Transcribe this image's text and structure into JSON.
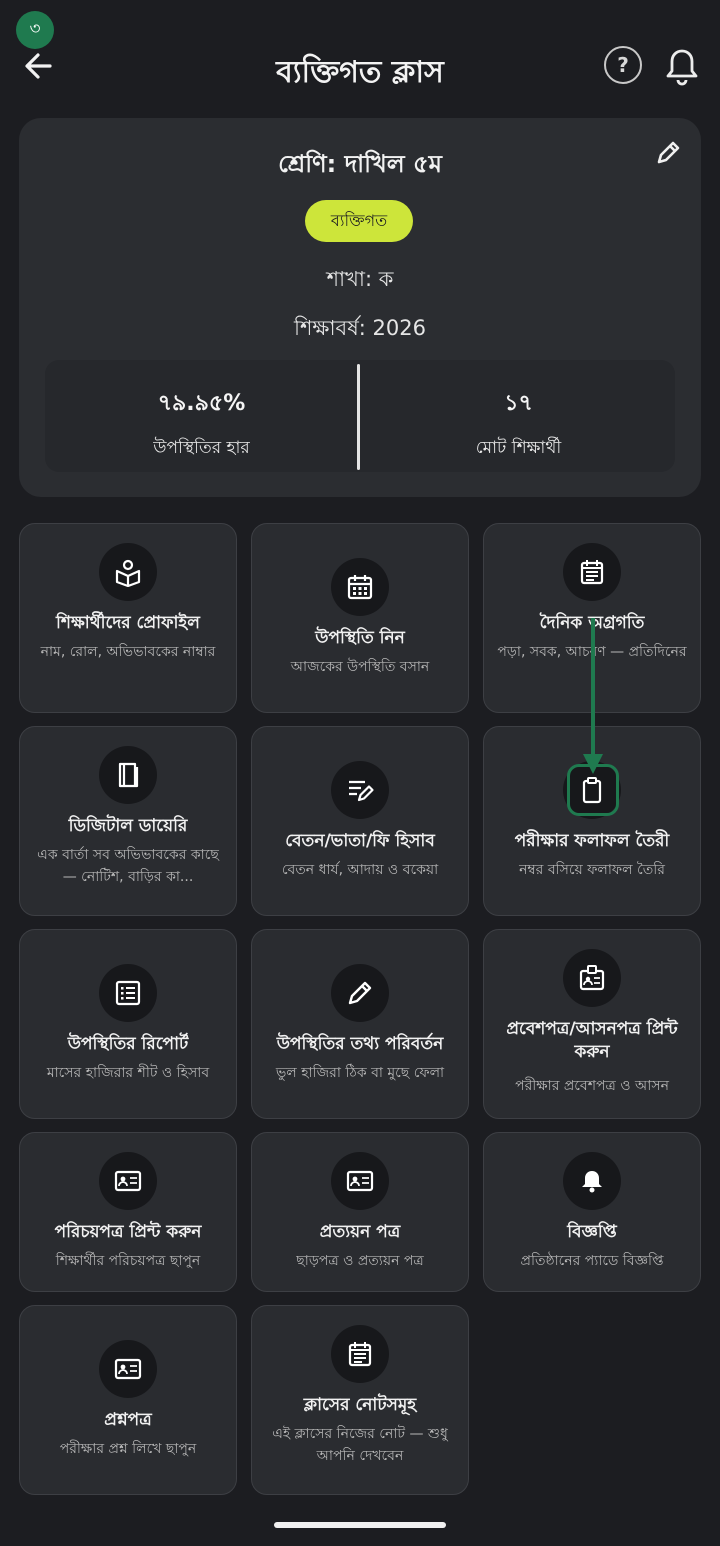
{
  "badge": "৩",
  "header": {
    "title": "ব্যক্তিগত ক্লাস",
    "help": "?"
  },
  "info": {
    "class_title": "শ্রেণি: দাখিল ৫ম",
    "type_chip": "ব্যক্তিগত",
    "section": "শাখা: ক",
    "year": "শিক্ষাবর্ষ: 2026",
    "attendance_rate": "৭৯.৯৫%",
    "attendance_label": "উপস্থিতির হার",
    "total_students": "১৭",
    "total_students_label": "মোট শিক্ষার্থী"
  },
  "tiles": [
    {
      "title": "শিক্ষার্থীদের প্রোফাইল",
      "sub": "নাম, রোল, অভিভাবকের নাম্বার",
      "icon": "student-profile-icon"
    },
    {
      "title": "উপস্থিতি নিন",
      "sub": "আজকের উপস্থিতি বসান",
      "icon": "calendar-icon"
    },
    {
      "title": "দৈনিক অগ্রগতি",
      "sub": "পড়া, সবক, আচরণ — প্রতিদিনের",
      "icon": "daily-log-icon"
    },
    {
      "title": "ডিজিটাল ডায়েরি",
      "sub": "এক বার্তা সব অভিভাবকের কাছে — নোটিশ, বাড়ির কা...",
      "icon": "book-icon"
    },
    {
      "title": "বেতন/ভাতা/ফি হিসাব",
      "sub": "বেতন ধার্য, আদায় ও বকেয়া",
      "icon": "edit-note-icon"
    },
    {
      "title": "পরীক্ষার ফলাফল তৈরী",
      "sub": "নম্বর বসিয়ে ফলাফল তৈরি",
      "icon": "clipboard-icon"
    },
    {
      "title": "উপস্থিতির রিপোর্ট",
      "sub": "মাসের হাজিরার শীট ও হিসাব",
      "icon": "report-list-icon"
    },
    {
      "title": "উপস্থিতির তথ্য পরিবর্তন",
      "sub": "ভুল হাজিরা ঠিক বা মুছে ফেলা",
      "icon": "pencil-icon"
    },
    {
      "title": "প্রবেশপত্র/আসনপত্র প্রিন্ট করুন",
      "sub": "পরীক্ষার প্রবেশপত্র ও আসন",
      "icon": "badge-icon"
    },
    {
      "title": "পরিচয়পত্র প্রিন্ট করুন",
      "sub": "শিক্ষার্থীর পরিচয়পত্র ছাপুন",
      "icon": "id-card-icon"
    },
    {
      "title": "প্রত্যয়ন পত্র",
      "sub": "ছাড়পত্র ও প্রত্যয়ন পত্র",
      "icon": "certificate-icon"
    },
    {
      "title": "বিজ্ঞপ্তি",
      "sub": "প্রতিষ্ঠানের প্যাডে বিজ্ঞপ্তি",
      "icon": "bell-icon"
    },
    {
      "title": "প্রশ্নপত্র",
      "sub": "পরীক্ষার প্রশ্ন লিখে ছাপুন",
      "icon": "question-paper-icon"
    },
    {
      "title": "ক্লাসের নোটসমূহ",
      "sub": "এই ক্লাসের নিজের নোট — শুধু আপনি দেখবেন",
      "icon": "notes-icon"
    }
  ]
}
